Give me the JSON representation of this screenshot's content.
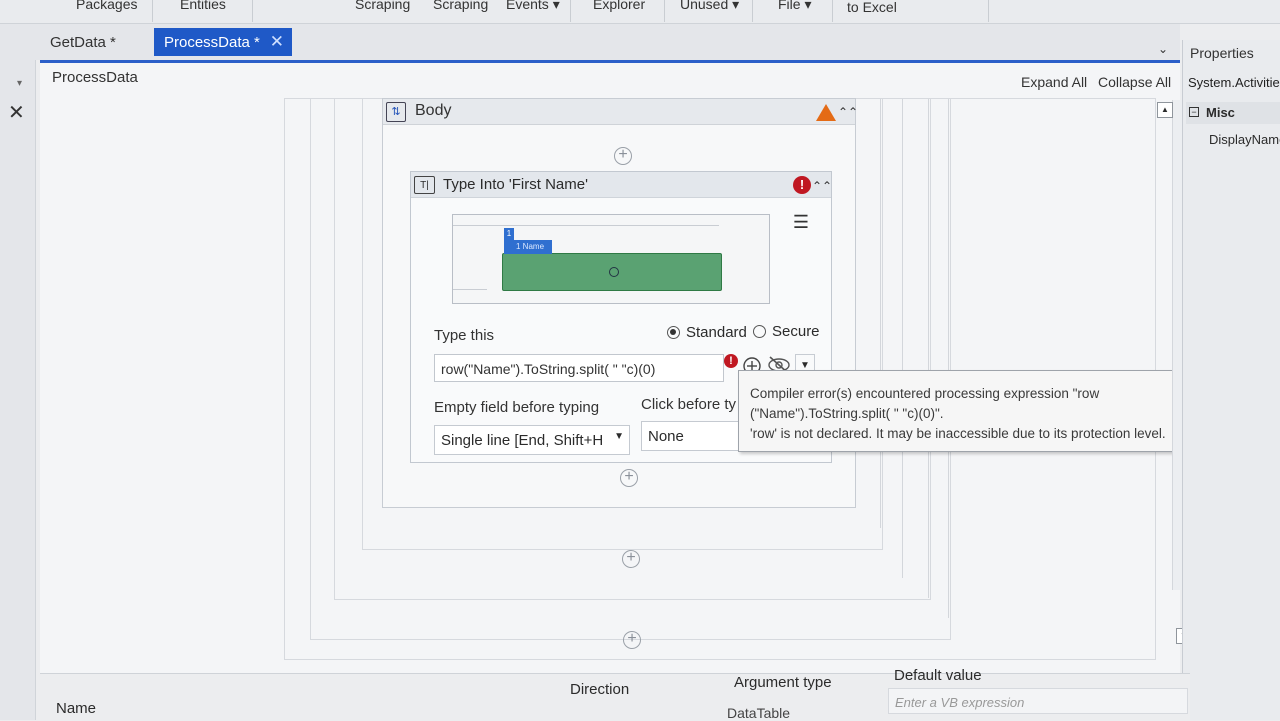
{
  "ribbon": {
    "items": [
      "Packages",
      "Entities",
      "Scraping",
      "Scraping",
      "Events",
      "Explorer",
      "Unused",
      "File",
      "to Excel"
    ]
  },
  "tabs": {
    "getdata": "GetData *",
    "processdata": "ProcessData *"
  },
  "designer": {
    "breadcrumb": "ProcessData",
    "expand_all": "Expand All",
    "collapse_all": "Collapse All"
  },
  "body_container": {
    "label": "Body"
  },
  "activity": {
    "title": "Type Into 'First Name'",
    "preview_badge": "1 Name",
    "type_this_label": "Type this",
    "radio_standard": "Standard",
    "radio_secure": "Secure",
    "expression_value": "row(\"Name\").ToString.split( \" \"c)(0)",
    "empty_field_label": "Empty field before typing",
    "empty_field_value": "Single line [End, Shift+H",
    "click_before_label": "Click before ty",
    "click_before_value": "None"
  },
  "tooltip": {
    "line1": "Compiler error(s) encountered processing expression \"row",
    "line2": "(\"Name\").ToString.split( \" \"c)(0)\".",
    "line3": "'row' is not declared. It may be inaccessible due to its protection level."
  },
  "properties": {
    "title": "Properties",
    "type": "System.Activities",
    "category": "Misc",
    "field": "DisplayName"
  },
  "arguments": {
    "col_name": "Name",
    "col_direction": "Direction",
    "col_type": "Argument type",
    "col_default": "Default value",
    "row_type": "DataTable",
    "row_default_placeholder": "Enter a VB expression"
  },
  "colors": {
    "active_tab": "#1f59c7",
    "error": "#c01822",
    "warning": "#e46b16",
    "element_highlight": "#5aa272"
  },
  "icons": [
    "pin-icon",
    "close-icon",
    "chevron-down-icon",
    "body-sequence-icon",
    "warning-icon",
    "collapse-icon",
    "type-into-icon",
    "error-icon",
    "hamburger-menu-icon",
    "add-circle-icon",
    "eye-hidden-icon",
    "dropdown-arrow-icon"
  ]
}
